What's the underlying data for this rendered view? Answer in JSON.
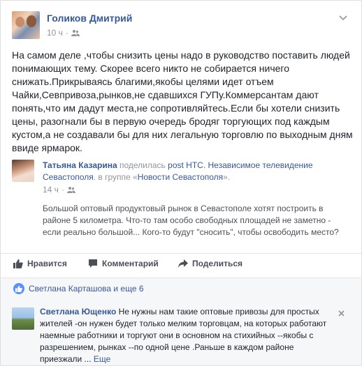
{
  "post": {
    "author": "Голиков Дмитрий",
    "time": "10 ч",
    "text": "На самом деле ,чтобы снизить цены надо в руководство поставить людей понимающих тему. Скорее всего никто не собирается ничего снижать.Прикрываясь благими,якобы целями идет отъем Чайки,Севпривоза,рынков,не сдавшихся ГУПу.Коммерсантам дают понять,что им дадут места,не сопротивляйтесь.Если бы хотели снизить цены, разогнали бы в первую очередь бродяг торгующих под каждым кустом,а не создавали бы для них легальную торговлю по выходным дням ввиде ярмарок."
  },
  "shared": {
    "author": "Татьяна Казарина",
    "shared_word": "поделилась",
    "post_link": "post НТС. Независимое телевидение Севастополя",
    "group_prefix": ". в группе «",
    "group_name": "Новости Севастополя",
    "group_suffix": "».",
    "time": "14 ч",
    "text": "Большой оптовый продуктовый рынок в Севастополе хотят построить в районе 5 километра. Что-то там особо свободных площадей не заметно - если реально большой... Кого-то будут \"сносить\", чтобы освободить место?"
  },
  "actions": {
    "like": "Нравится",
    "comment": "Комментарий",
    "share": "Поделиться"
  },
  "likes": {
    "text": "Светлана Карташова и еще 6"
  },
  "comment": {
    "author": "Светлана Ющенко",
    "text": "Не нужны нам такие оптовые привозы для простых жителей -он нужен будет только мелким торговцам, на которых работают наемные работники и торгуют они в основном на стихийных --якобы с разрешением, рынках --по одной цене .Раньше в каждом районе приезжали",
    "ellipsis": " ... ",
    "more": "Еще"
  },
  "colors": {
    "link": "#365899",
    "like_blue": "#5890ff",
    "muted": "#90949c"
  }
}
